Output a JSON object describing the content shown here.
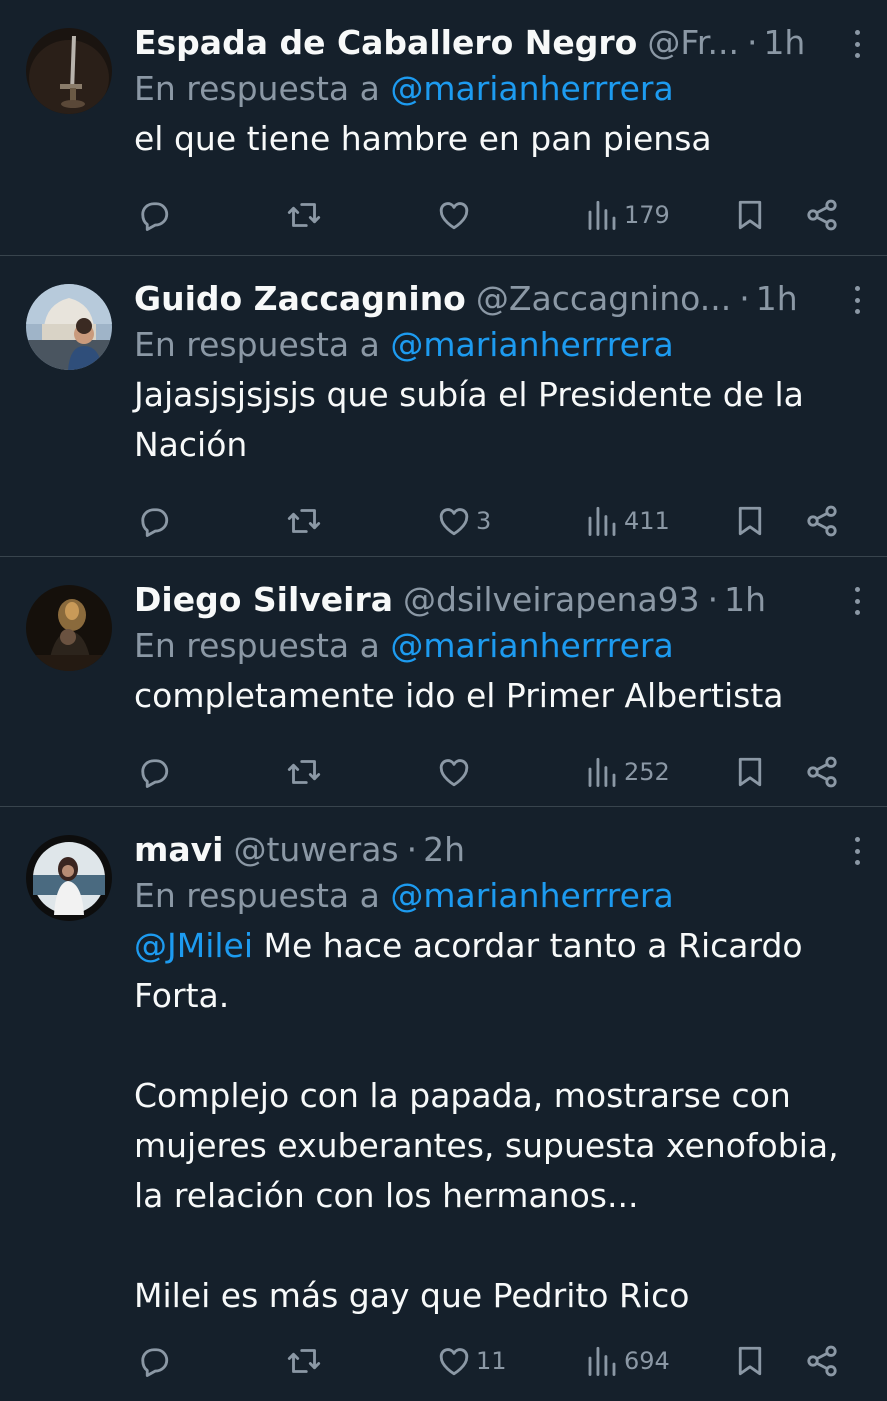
{
  "tweets": [
    {
      "name": "Espada de Caballero Negro",
      "handle": "@Fr...",
      "time": "1h",
      "reply_prefix": "En respuesta a",
      "reply_to": "@marianherrrera",
      "text": "el que tiene hambre en pan piensa",
      "likes": "",
      "views": "179",
      "avatar_icon": "sword-avatar"
    },
    {
      "name": "Guido Zaccagnino",
      "handle": "@Zaccagnino...",
      "time": "1h",
      "reply_prefix": "En respuesta a",
      "reply_to": "@marianherrrera",
      "text": "Jajasjsjsjsjs que subía el Presidente de la Nación",
      "likes": "3",
      "views": "411",
      "avatar_icon": "person-photo-avatar"
    },
    {
      "name": "Diego Silveira",
      "handle": "@dsilveirapena93",
      "time": "1h",
      "reply_prefix": "En respuesta a",
      "reply_to": "@marianherrrera",
      "text": "completamente ido el Primer Albertista",
      "likes": "",
      "views": "252",
      "avatar_icon": "dark-photo-avatar"
    },
    {
      "name": "mavi",
      "handle": "@tuweras",
      "time": "2h",
      "reply_prefix": "En respuesta a",
      "reply_to": "@marianherrrera",
      "text_mention": "@JMilei",
      "text": " Me hace acordar tanto a Ricardo Forta.\n\nComplejo con la papada, mostrarse con mujeres exuberantes, supuesta xenofobia, la relación con los hermanos...\n\nMilei es más gay que Pedrito Rico",
      "likes": "11",
      "views": "694",
      "avatar_icon": "person-photo-avatar"
    }
  ],
  "separator": "·",
  "colors": {
    "background": "#15202b",
    "text": "#f7f9f9",
    "muted": "#8b98a5",
    "link": "#1d9bf0",
    "border": "#38444d"
  },
  "icons": [
    "reply-icon",
    "retweet-icon",
    "like-icon",
    "views-icon",
    "bookmark-icon",
    "share-icon",
    "more-icon"
  ]
}
